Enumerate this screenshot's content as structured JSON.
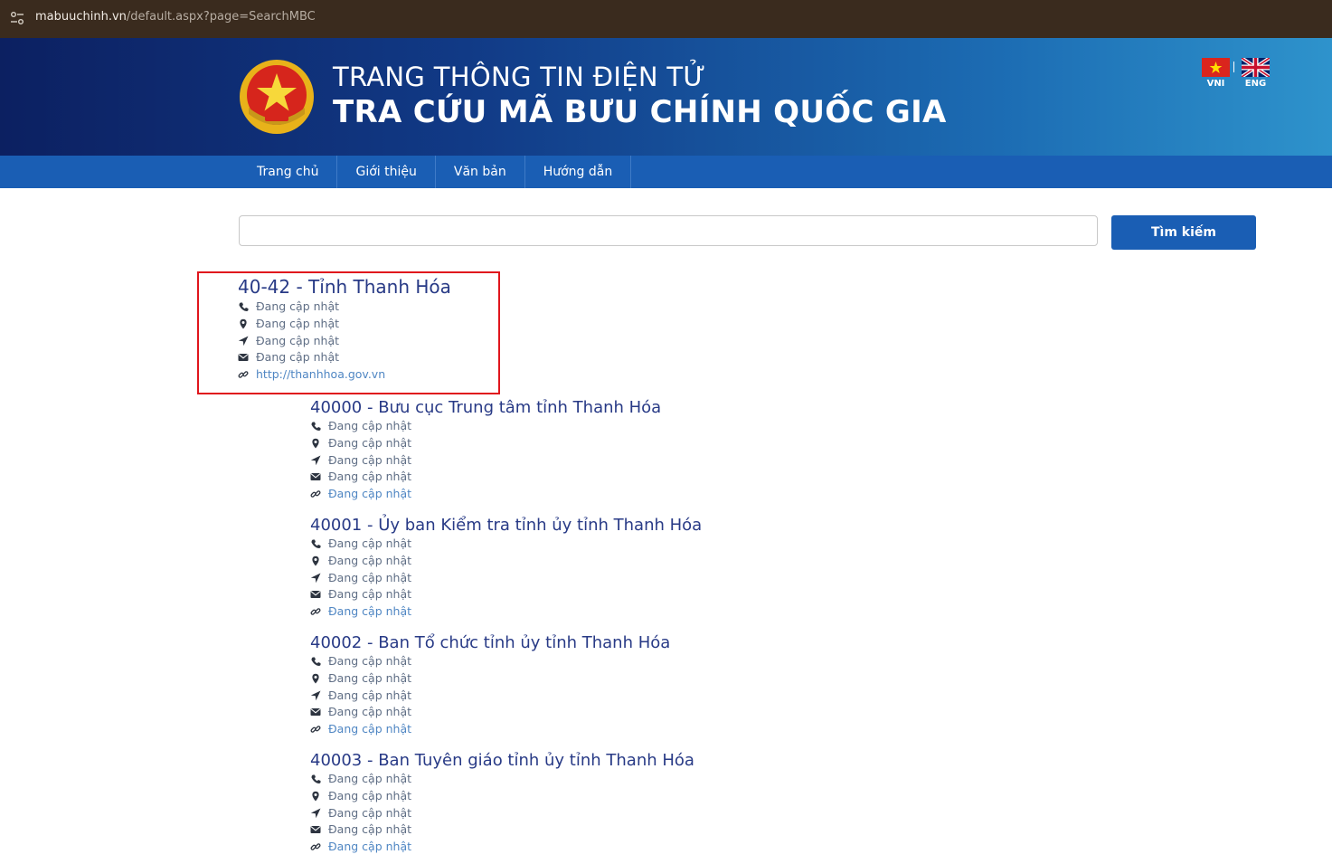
{
  "browser": {
    "url_domain": "mabuuchinh.vn",
    "url_path": "/default.aspx?page=SearchMBC"
  },
  "header": {
    "title_line1": "TRANG THÔNG TIN ĐIỆN TỬ",
    "title_line2": "TRA CỨU MÃ BƯU CHÍNH QUỐC GIA",
    "lang_vn": "VNI",
    "lang_en": "ENG"
  },
  "nav": {
    "items": [
      "Trang chủ",
      "Giới thiệu",
      "Văn bản",
      "Hướng dẫn"
    ]
  },
  "search": {
    "value": "",
    "button_label": "Tìm kiếm"
  },
  "results": [
    {
      "title": "40-42 - Tỉnh Thanh Hóa",
      "phone": "Đang cập nhật",
      "address": "Đang cập nhật",
      "location": "Đang cập nhật",
      "email": "Đang cập nhật",
      "website": "http://thanhhoa.gov.vn"
    },
    {
      "title": "40000 - Bưu cục Trung tâm tỉnh Thanh Hóa",
      "phone": "Đang cập nhật",
      "address": "Đang cập nhật",
      "location": "Đang cập nhật",
      "email": "Đang cập nhật",
      "website": "Đang cập nhật"
    },
    {
      "title": "40001 - Ủy ban Kiểm tra tỉnh ủy tỉnh Thanh Hóa",
      "phone": "Đang cập nhật",
      "address": "Đang cập nhật",
      "location": "Đang cập nhật",
      "email": "Đang cập nhật",
      "website": "Đang cập nhật"
    },
    {
      "title": "40002 - Ban Tổ chức tỉnh ủy tỉnh Thanh Hóa",
      "phone": "Đang cập nhật",
      "address": "Đang cập nhật",
      "location": "Đang cập nhật",
      "email": "Đang cập nhật",
      "website": "Đang cập nhật"
    },
    {
      "title": "40003 - Ban Tuyên giáo tỉnh ủy tỉnh Thanh Hóa",
      "phone": "Đang cập nhật",
      "address": "Đang cập nhật",
      "location": "Đang cập nhật",
      "email": "Đang cập nhật",
      "website": "Đang cập nhật"
    }
  ],
  "icons": {
    "phone": "phone-icon",
    "address": "map-marker-icon",
    "location": "location-arrow-icon",
    "email": "envelope-icon",
    "website": "link-icon"
  },
  "colors": {
    "nav_bg": "#1a5eb4",
    "title_text": "#283a86",
    "highlight_border": "#e0161d",
    "link_text": "#4f86c3"
  }
}
